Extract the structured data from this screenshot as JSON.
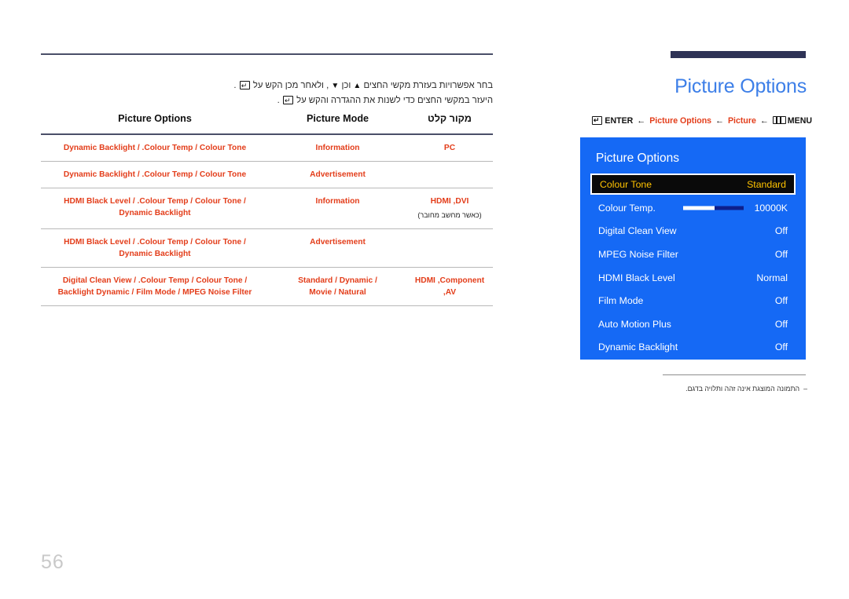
{
  "page": {
    "number": "56"
  },
  "left": {
    "instructions": {
      "line1_before": "בחר אפשרויות בעזרת מקשי החצים",
      "line1_up": "▲",
      "line1_mid": "וכן",
      "line1_down": "▼",
      "line1_after": ", ולאחר מכן הקש על",
      "line1_end": ".",
      "line2_before": "היעזר במקשי החצים כדי לשנות את ההגדרה והקש על",
      "line2_end": "."
    },
    "table": {
      "headers": {
        "source": "מקור קלט",
        "mode": "Picture Mode",
        "options": "Picture Options"
      },
      "rows": [
        {
          "source": "PC",
          "source_note": "",
          "mode": "Information",
          "options": "Dynamic Backlight / .Colour Temp / Colour Tone"
        },
        {
          "source": "",
          "source_note": "",
          "mode": "Advertisement",
          "options": "Dynamic Backlight / .Colour Temp / Colour Tone"
        },
        {
          "source": "HDMI ,DVI",
          "source_note": "(כאשר מחשב מחובר)",
          "mode": "Information",
          "options": "/ HDMI Black Level / .Colour Temp / Colour Tone\nDynamic Backlight"
        },
        {
          "source": "",
          "source_note": "",
          "mode": "Advertisement",
          "options": "/ HDMI Black Level / .Colour Temp / Colour Tone\nDynamic Backlight"
        },
        {
          "source": "HDMI ,Component ,AV",
          "source_note": "",
          "mode": "/ Standard / Dynamic\nMovie / Natural",
          "options": "/ Digital Clean View / .Colour Temp / Colour Tone\nBacklight Dynamic / Film Mode / MPEG Noise Filter"
        }
      ]
    }
  },
  "right": {
    "title": "Picture Options",
    "breadcrumb": {
      "enter": "ENTER",
      "arrow": "←",
      "picture_options": "Picture Options",
      "picture": "Picture",
      "menu": "MENU"
    },
    "osd": {
      "title": "Picture Options",
      "rows": [
        {
          "label": "Colour Tone",
          "value": "Standard",
          "selected": true,
          "slider": false
        },
        {
          "label": "Colour Temp.",
          "value": "10000K",
          "selected": false,
          "slider": true
        },
        {
          "label": "Digital Clean View",
          "value": "Off",
          "selected": false,
          "slider": false
        },
        {
          "label": "MPEG Noise Filter",
          "value": "Off",
          "selected": false,
          "slider": false
        },
        {
          "label": "HDMI Black Level",
          "value": "Normal",
          "selected": false,
          "slider": false
        },
        {
          "label": "Film Mode",
          "value": "Off",
          "selected": false,
          "slider": false
        },
        {
          "label": "Auto Motion Plus",
          "value": "Off",
          "selected": false,
          "slider": false
        },
        {
          "label": "Dynamic Backlight",
          "value": "Off",
          "selected": false,
          "slider": false
        }
      ]
    },
    "caption": {
      "dash": "–",
      "text": "התמונה המוצגת אינה זהה ותלויה בדגם."
    }
  },
  "colors": {
    "accent_blue": "#3d7fe8",
    "osd_blue": "#1569f5",
    "red": "#e33d1a",
    "navy": "#2e3356",
    "highlight_gold": "#ffc300"
  }
}
